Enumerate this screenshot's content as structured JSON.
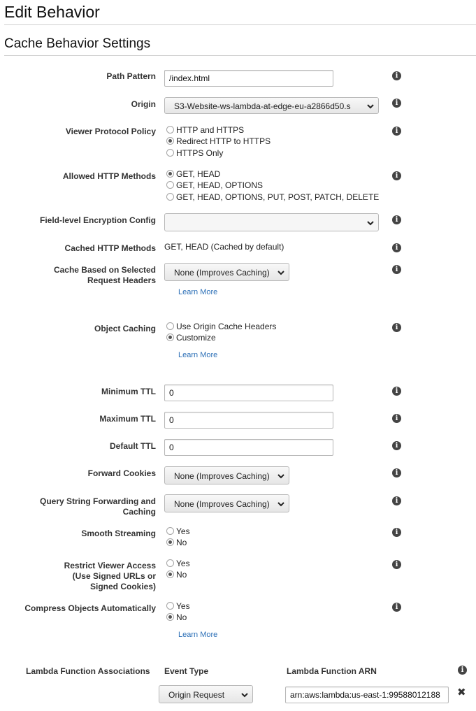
{
  "page": {
    "title": "Edit Behavior",
    "section_title": "Cache Behavior Settings"
  },
  "fields": {
    "path_pattern": {
      "label": "Path Pattern",
      "value": "/index.html"
    },
    "origin": {
      "label": "Origin",
      "value": "S3-Website-ws-lambda-at-edge-eu-a2866d50.s"
    },
    "viewer_protocol_policy": {
      "label": "Viewer Protocol Policy",
      "options": [
        "HTTP and HTTPS",
        "Redirect HTTP to HTTPS",
        "HTTPS Only"
      ],
      "selected": "Redirect HTTP to HTTPS"
    },
    "allowed_http_methods": {
      "label": "Allowed HTTP Methods",
      "options": [
        "GET, HEAD",
        "GET, HEAD, OPTIONS",
        "GET, HEAD, OPTIONS, PUT, POST, PATCH, DELETE"
      ],
      "selected": "GET, HEAD"
    },
    "field_level_encryption": {
      "label": "Field-level Encryption Config",
      "value": ""
    },
    "cached_http_methods": {
      "label": "Cached HTTP Methods",
      "value": "GET, HEAD (Cached by default)"
    },
    "cache_based_on_headers": {
      "label_line1": "Cache Based on Selected",
      "label_line2": "Request Headers",
      "value": "None (Improves Caching)",
      "learn_more": "Learn More"
    },
    "object_caching": {
      "label": "Object Caching",
      "options": [
        "Use Origin Cache Headers",
        "Customize"
      ],
      "selected": "Customize",
      "learn_more": "Learn More"
    },
    "minimum_ttl": {
      "label": "Minimum TTL",
      "value": "0"
    },
    "maximum_ttl": {
      "label": "Maximum TTL",
      "value": "0"
    },
    "default_ttl": {
      "label": "Default TTL",
      "value": "0"
    },
    "forward_cookies": {
      "label": "Forward Cookies",
      "value": "None (Improves Caching)"
    },
    "query_string": {
      "label_line1": "Query String Forwarding and",
      "label_line2": "Caching",
      "value": "None (Improves Caching)"
    },
    "smooth_streaming": {
      "label": "Smooth Streaming",
      "options": [
        "Yes",
        "No"
      ],
      "selected": "No"
    },
    "restrict_viewer_access": {
      "label_line1": "Restrict Viewer Access",
      "label_line2": "(Use Signed URLs or",
      "label_line3": "Signed Cookies)",
      "options": [
        "Yes",
        "No"
      ],
      "selected": "No"
    },
    "compress_objects": {
      "label": "Compress Objects Automatically",
      "options": [
        "Yes",
        "No"
      ],
      "selected": "No",
      "learn_more": "Learn More"
    }
  },
  "lambda": {
    "label": "Lambda Function Associations",
    "col_event_type": "Event Type",
    "col_arn": "Lambda Function ARN",
    "event_type": "Origin Request",
    "arn": "arn:aws:lambda:us-east-1:99588012188"
  },
  "icons": {
    "info": "info-icon",
    "chevron": "chevron-down-icon",
    "remove": "close-icon"
  }
}
